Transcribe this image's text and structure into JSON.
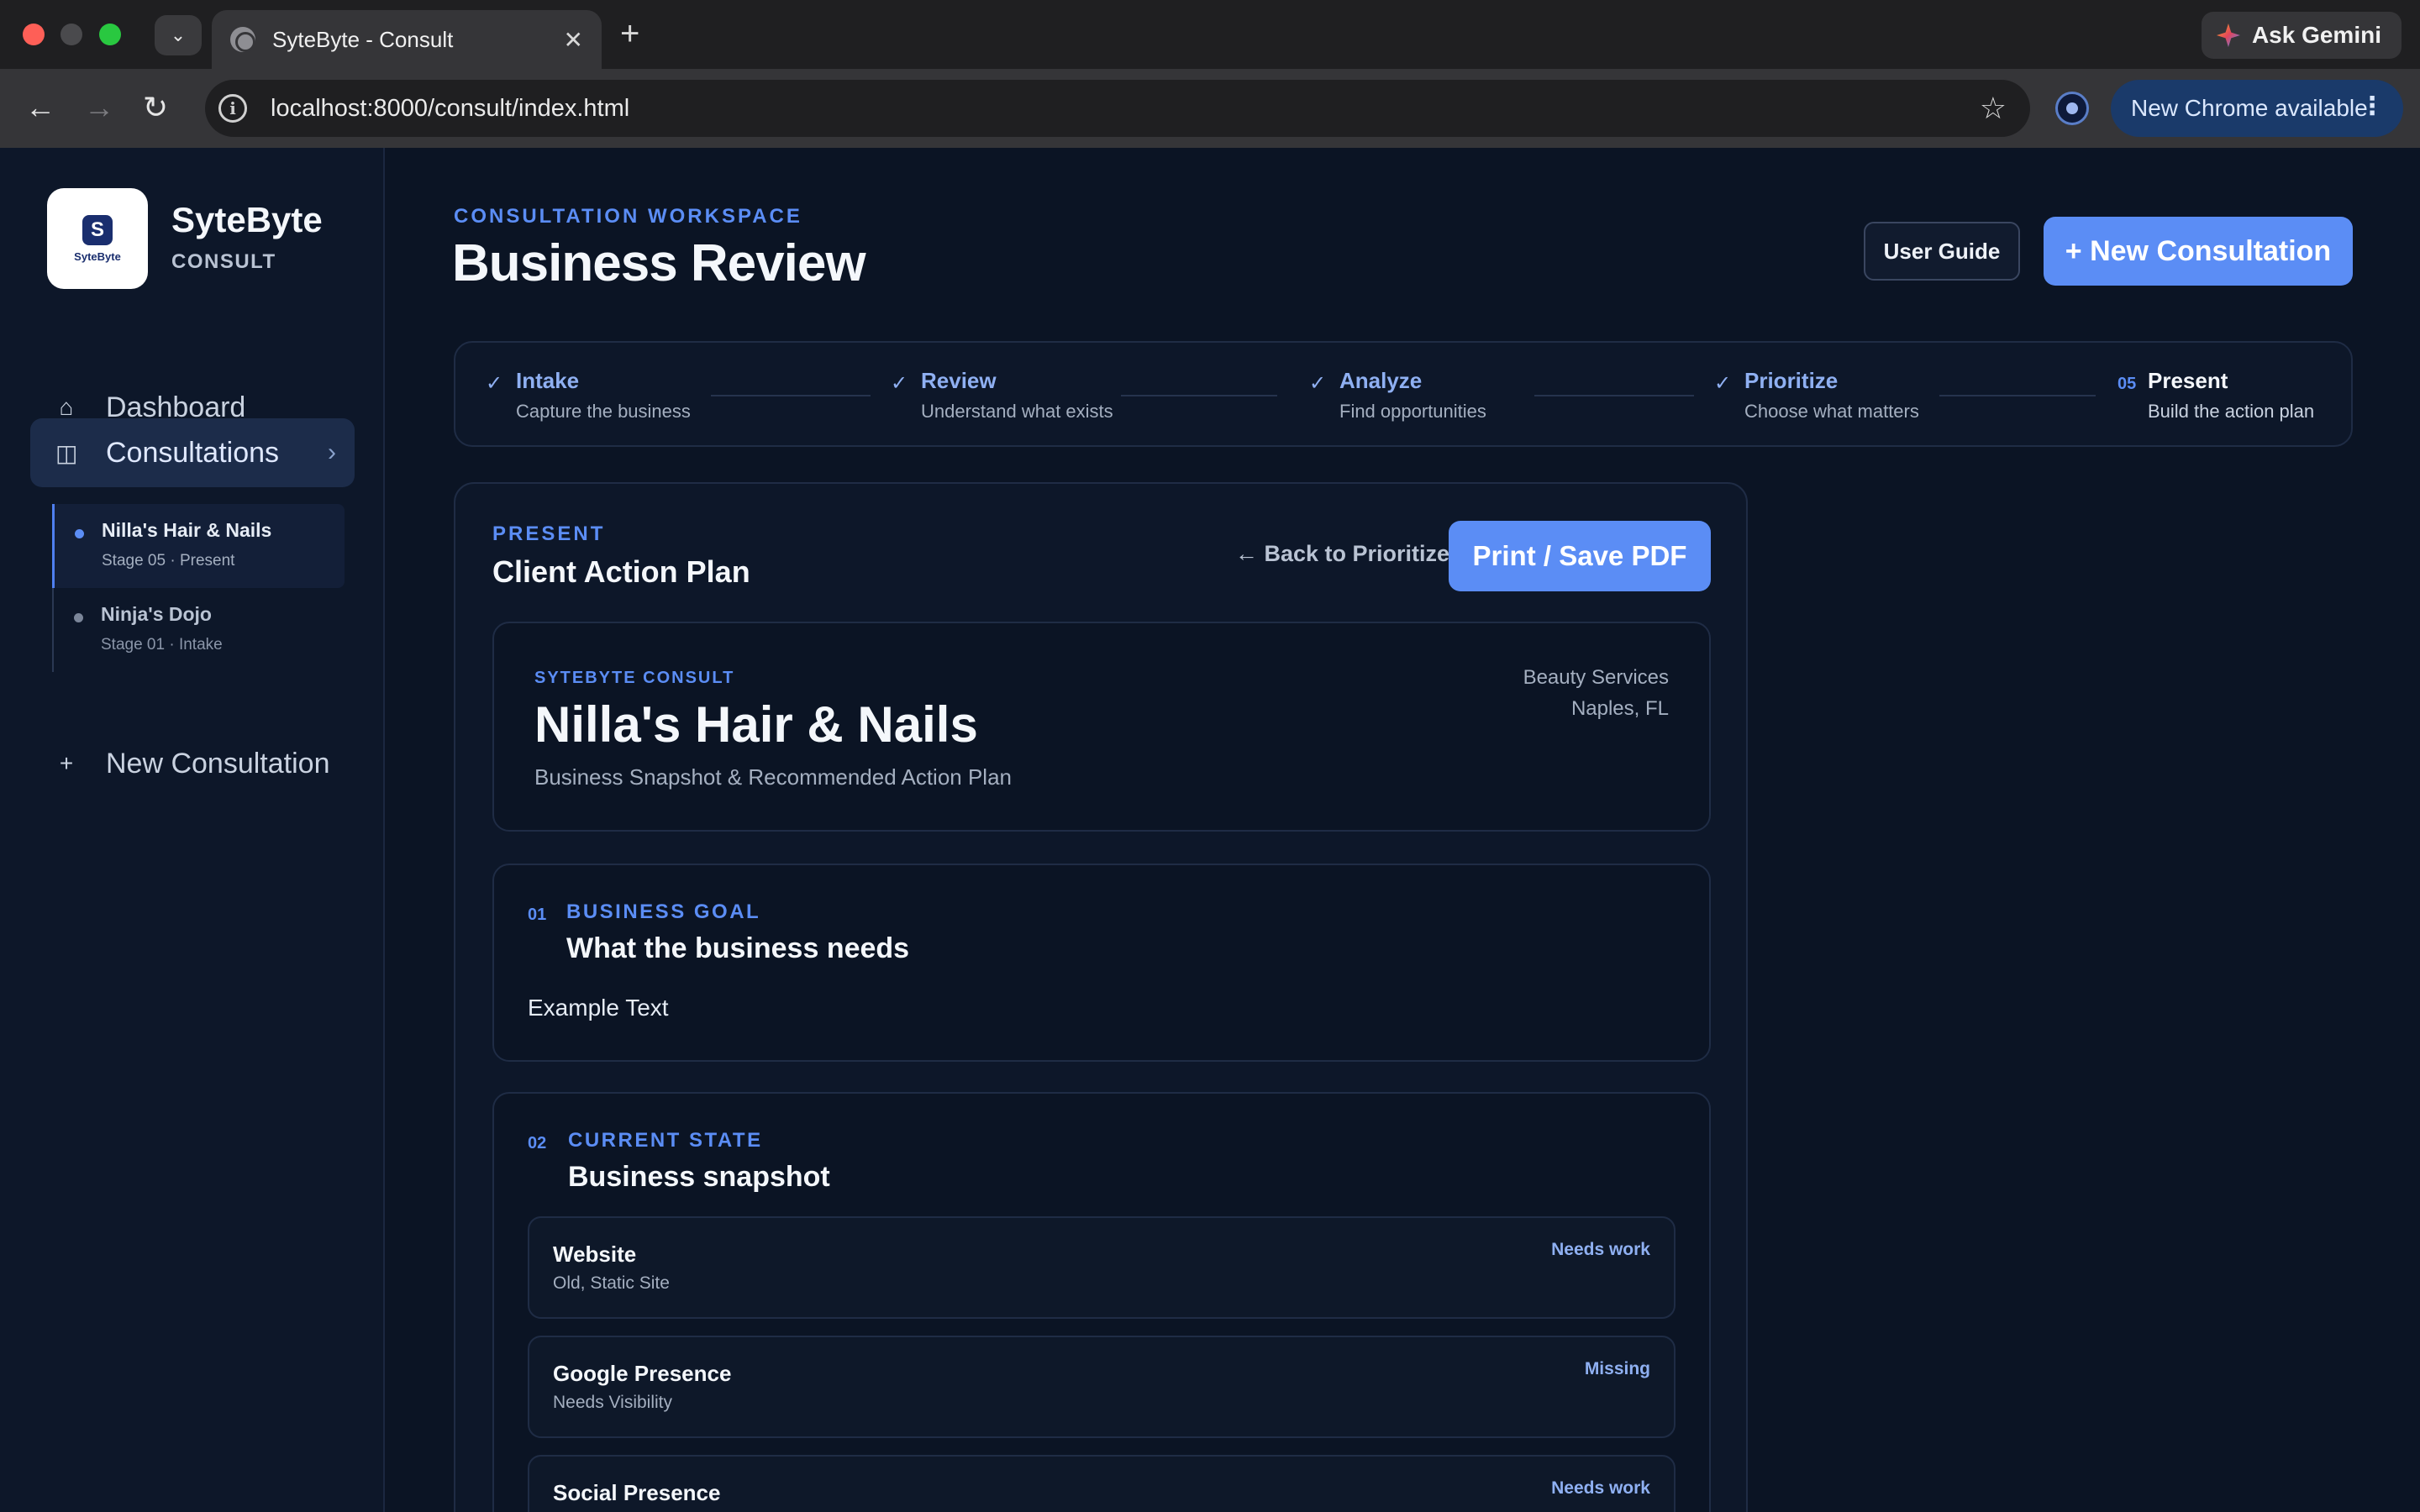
{
  "browser": {
    "tab_title": "SyteByte - Consult",
    "url": "localhost:8000/consult/index.html",
    "gemini_label": "Ask Gemini",
    "update_label": "New Chrome available"
  },
  "sidebar": {
    "brand": "SyteByte",
    "brand_sub": "CONSULT",
    "logo_text": "SyteByte",
    "nav": {
      "dashboard": "Dashboard",
      "consultations": "Consultations",
      "new_consultation": "New Consultation"
    },
    "consultations": [
      {
        "name": "Nilla's Hair & Nails",
        "meta": "Stage 05 · Present"
      },
      {
        "name": "Ninja's Dojo",
        "meta": "Stage 01 · Intake"
      }
    ]
  },
  "header": {
    "eyebrow": "CONSULTATION WORKSPACE",
    "title": "Business Review",
    "user_guide": "User Guide",
    "new_consultation": "+ New Consultation"
  },
  "stepper": [
    {
      "mark": "✓",
      "label": "Intake",
      "desc": "Capture the business"
    },
    {
      "mark": "✓",
      "label": "Review",
      "desc": "Understand what exists"
    },
    {
      "mark": "✓",
      "label": "Analyze",
      "desc": "Find opportunities"
    },
    {
      "mark": "✓",
      "label": "Prioritize",
      "desc": "Choose what matters"
    },
    {
      "mark": "05",
      "label": "Present",
      "desc": "Build the action plan"
    }
  ],
  "plan": {
    "eyebrow": "PRESENT",
    "title": "Client Action Plan",
    "back": "← Back to Prioritize",
    "print": "Print / Save PDF",
    "cover": {
      "eyebrow": "SYTEBYTE CONSULT",
      "business": "Nilla's Hair & Nails",
      "subtitle": "Business Snapshot & Recommended Action Plan",
      "industry": "Beauty Services",
      "location": "Naples, FL"
    },
    "goal": {
      "num": "01",
      "eyebrow": "BUSINESS GOAL",
      "title": "What the business needs",
      "body": "Example Text"
    },
    "state": {
      "num": "02",
      "eyebrow": "CURRENT STATE",
      "title": "Business snapshot",
      "items": [
        {
          "name": "Website",
          "desc": "Old, Static Site",
          "status": "Needs work"
        },
        {
          "name": "Google Presence",
          "desc": "Needs Visibility",
          "status": "Missing"
        },
        {
          "name": "Social Presence",
          "desc": "",
          "status": "Needs work"
        }
      ]
    }
  },
  "colors": {
    "accent": "#5b8df5",
    "background": "#0b1424",
    "panel": "#0d1729",
    "active_nav": "#1c2c4a"
  }
}
